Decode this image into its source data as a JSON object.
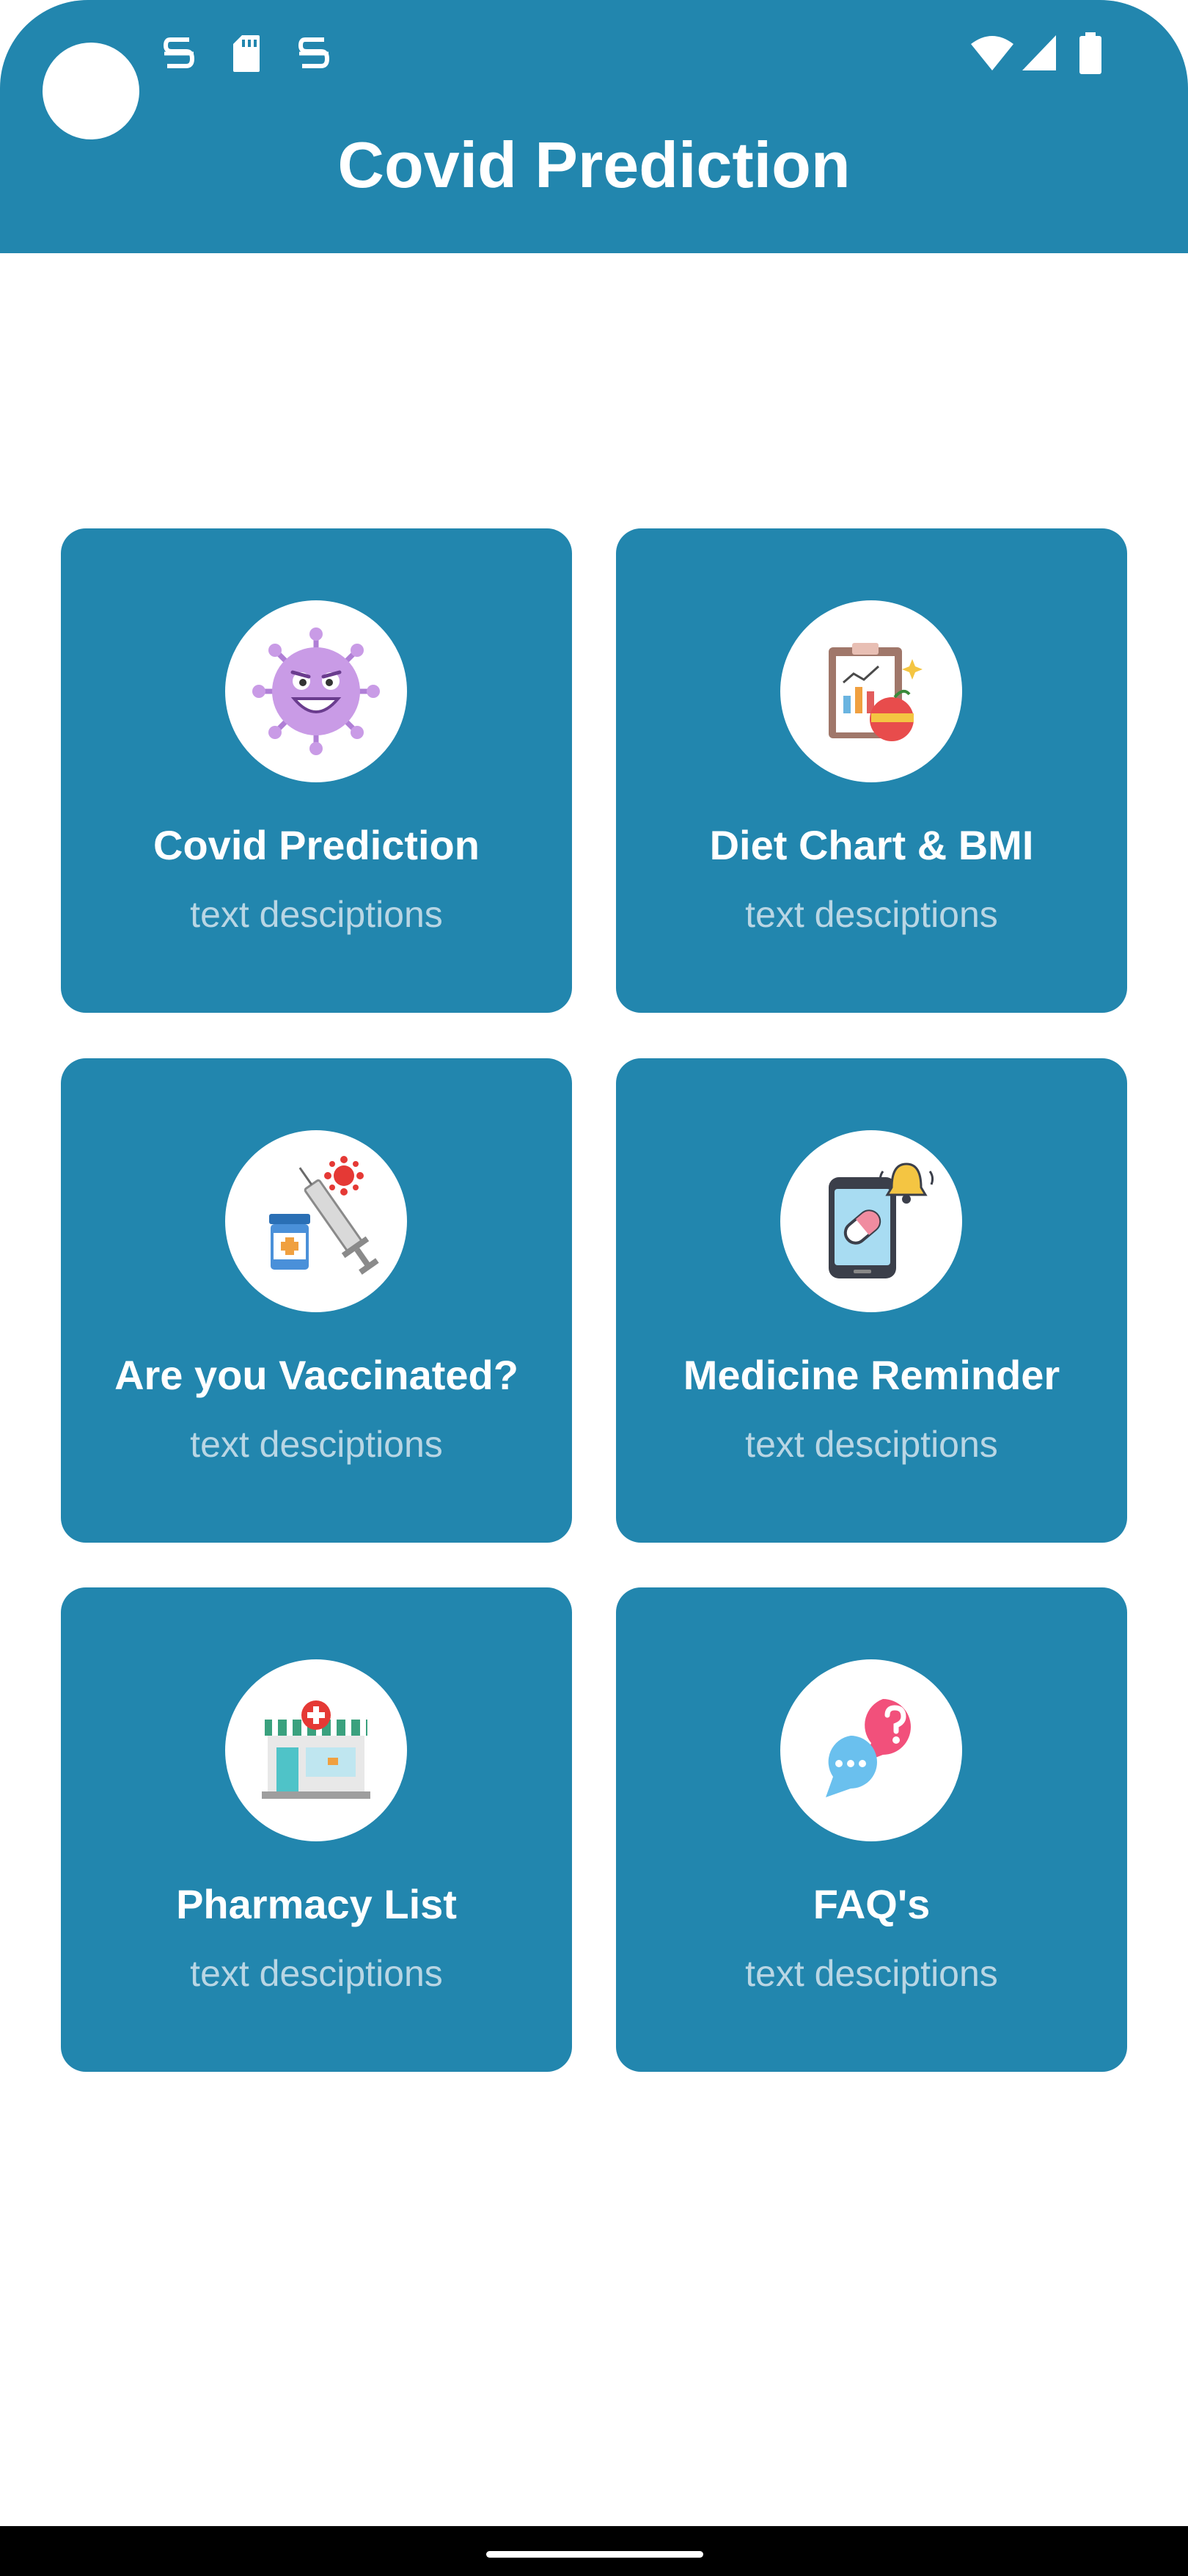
{
  "status_bar": {
    "icons": [
      "notification-icon",
      "sd-card-icon",
      "notification-icon",
      "wifi-icon",
      "signal-icon",
      "battery-icon"
    ]
  },
  "app_bar": {
    "title": "Covid Prediction",
    "color": "#2286ae"
  },
  "cards": [
    {
      "title": "Covid Prediction",
      "description": "text desciptions",
      "icon": "virus-icon"
    },
    {
      "title": "Diet Chart & BMI",
      "description": "text desciptions",
      "icon": "diet-chart-icon"
    },
    {
      "title": "Are you Vaccinated?",
      "description": "text desciptions",
      "icon": "vaccine-icon"
    },
    {
      "title": "Medicine Reminder",
      "description": "text desciptions",
      "icon": "medicine-reminder-icon"
    },
    {
      "title": "Pharmacy List",
      "description": "text desciptions",
      "icon": "pharmacy-icon"
    },
    {
      "title": "FAQ's",
      "description": "text desciptions",
      "icon": "faq-icon"
    }
  ]
}
